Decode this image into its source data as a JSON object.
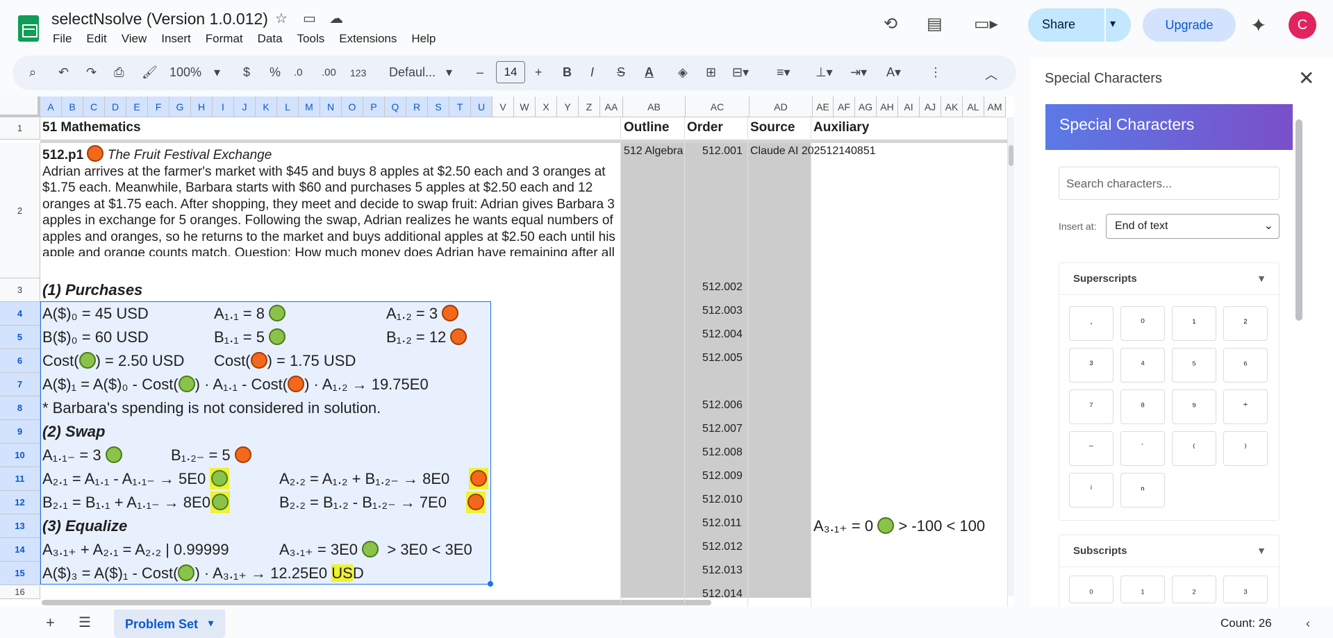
{
  "app": {
    "title": "selectNsolve (Version 1.0.012)",
    "star_icon": "star-icon",
    "menu": [
      "File",
      "Edit",
      "View",
      "Insert",
      "Format",
      "Data",
      "Tools",
      "Extensions",
      "Help"
    ],
    "share_label": "Share",
    "upgrade_label": "Upgrade",
    "avatar_letter": "C"
  },
  "toolbar": {
    "zoom": "100%",
    "currency": "$",
    "percent": "%",
    "dec_less": ".0",
    "dec_more": ".00",
    "number_format": "123",
    "font": "Defaul...",
    "font_size": "14",
    "bold": "B",
    "italic": "I",
    "strike": "S",
    "textcolor": "A"
  },
  "columns": [
    "A",
    "B",
    "C",
    "D",
    "E",
    "F",
    "G",
    "H",
    "I",
    "J",
    "K",
    "L",
    "M",
    "N",
    "O",
    "P",
    "Q",
    "R",
    "S",
    "T",
    "U",
    "V",
    "W",
    "X",
    "Y",
    "Z",
    "AA",
    "AB",
    "AC",
    "AD",
    "AE",
    "AF",
    "AG",
    "AH",
    "AI",
    "AJ",
    "AK",
    "AL",
    "AM"
  ],
  "rows": [
    "1",
    "2",
    "3",
    "4",
    "5",
    "6",
    "7",
    "8",
    "9",
    "10",
    "11",
    "12",
    "13",
    "14",
    "15",
    "16"
  ],
  "sheet": {
    "r1_a": "51 Mathematics",
    "r1_ab": "Outline",
    "r1_ac": "Order",
    "r1_ad": "Source",
    "r1_ae": "Auxiliary",
    "r2_a_head": "512.p1",
    "r2_a_title": "The Fruit Festival Exchange",
    "r2_a_body": "Adrian arrives at the farmer's market with $45 and buys 8 apples at $2.50 each and 3 oranges at $1.75 each. Meanwhile, Barbara starts with $60 and purchases 5 apples at $2.50 each and 12 oranges at $1.75 each. After shopping, they meet and decide to swap fruit: Adrian gives Barbara 3 apples in exchange for 5 oranges. Following the swap, Adrian realizes he wants equal numbers of apples and oranges, so he returns to the market and buys additional apples at $2.50 each until his apple and orange counts match. Question: How much money does Adrian have remaining after all transactions are complete?",
    "r2_ab": "512 Algebra",
    "r2_ac": "512.001",
    "r2_ad": "Claude AI 202512140851",
    "r3_a": "(1) Purchases",
    "r3_ac": "512.002",
    "r4_a1": "A($)₀ = 45 USD",
    "r4_a2": "A₁.₁ = 8",
    "r4_a3": "A₁.₂ = 3",
    "r4_ac": "512.003",
    "r5_a1": "B($)₀ = 60 USD",
    "r5_a2": "B₁.₁ = 5",
    "r5_a3": "B₁.₂ = 12",
    "r5_ac": "512.004",
    "r6_a1a": "Cost(",
    "r6_a1b": ") = 2.50 USD",
    "r6_a2a": "Cost(",
    "r6_a2b": ") = 1.75 USD",
    "r6_ac": "512.005",
    "r7_a_1": "A($)₁ = A($)₀ - Cost(",
    "r7_a_2": ") · A₁.₁ - Cost(",
    "r7_a_3": ") · A₁.₂ → 19.75E0",
    "r8_a": "* Barbara's spending is not considered in solution.",
    "r8_ac": "512.006",
    "r9_a": "(2) Swap",
    "r9_ac": "512.007",
    "r10_a1": "A₁.₁₋ = 3",
    "r10_a2": "B₁.₂₋ = 5",
    "r10_ac": "512.008",
    "r11_a1": "A₂.₁ = A₁.₁ - A₁.₁₋ → 5E0",
    "r11_a2": "A₂.₂ = A₁.₂ + B₁.₂₋ → 8E0",
    "r11_ac": "512.009",
    "r12_a1": "B₂.₁ = B₁.₁ + A₁.₁₋ → 8E0",
    "r12_a2": "B₂.₂ = B₁.₂ - B₁.₂₋ → 7E0",
    "r12_ac": "512.010",
    "r13_a": "(3) Equalize",
    "r13_ac": "512.011",
    "r13_ae_1": "A₃.₁₊ = 0",
    "r13_ae_2": "> -100 < 100",
    "r14_a1": "A₃.₁₊ + A₂.₁ = A₂.₂ | 0.99999",
    "r14_a2": "A₃.₁₊ = 3E0",
    "r14_a3": "> 3E0 < 3E0",
    "r14_ac": "512.012",
    "r15_a_1": "A($)₃ = A($)₁ - Cost(",
    "r15_a_2": ") · A₃.₁₊ → 12.25E0",
    "r15_a_3": "US",
    "r15_a_4": "D",
    "r15_ac": "512.013",
    "r16_ac": "512.014"
  },
  "panel": {
    "title": "Special Characters",
    "banner": "Special Characters",
    "search_placeholder": "Search characters...",
    "insert_at_label": "Insert at:",
    "insert_at_value": "End of text",
    "superscripts_title": "Superscripts",
    "superscripts": [
      "·",
      "⁰",
      "¹",
      "²",
      "³",
      "⁴",
      "⁵",
      "⁶",
      "⁷",
      "⁸",
      "⁹",
      "⁺",
      "⁻",
      "˙",
      "⁽",
      "⁾",
      "ⁱ",
      "ⁿ"
    ],
    "subscripts_title": "Subscripts",
    "subscripts": [
      "₀",
      "₁",
      "₂",
      "₃"
    ]
  },
  "bottom": {
    "sheet_tab": "Problem Set",
    "count": "Count: 26"
  },
  "colors": {
    "selection": "#e8f0fe",
    "selection_border": "#1a73e8",
    "grey_col": "#cccccc",
    "highlight": "#eef230",
    "apple": "#8bc34a",
    "orange": "#f4681c"
  }
}
